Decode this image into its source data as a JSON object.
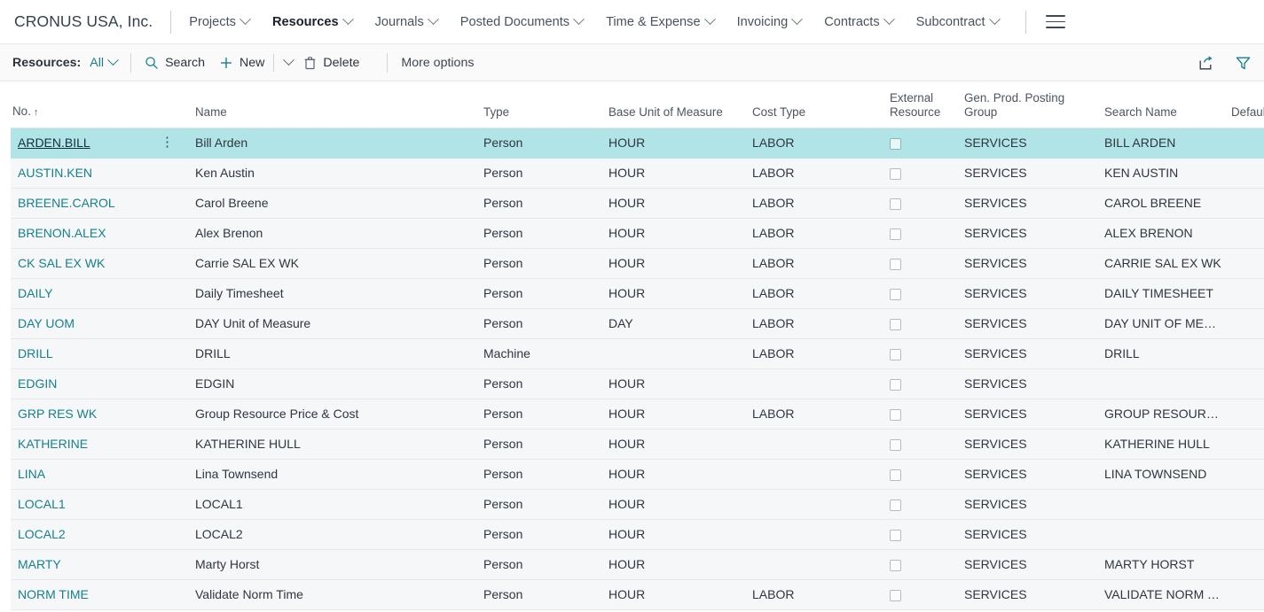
{
  "header": {
    "company": "CRONUS USA, Inc.",
    "nav": [
      {
        "label": "Projects",
        "active": false,
        "has_chevron": true
      },
      {
        "label": "Resources",
        "active": true,
        "has_chevron": true
      },
      {
        "label": "Journals",
        "active": false,
        "has_chevron": true
      },
      {
        "label": "Posted Documents",
        "active": false,
        "has_chevron": true
      },
      {
        "label": "Time & Expense",
        "active": false,
        "has_chevron": true
      },
      {
        "label": "Invoicing",
        "active": false,
        "has_chevron": true
      },
      {
        "label": "Contracts",
        "active": false,
        "has_chevron": true
      },
      {
        "label": "Subcontract",
        "active": false,
        "has_chevron": true
      }
    ],
    "menu_icon": "hamburger-icon"
  },
  "toolbar": {
    "list_label": "Resources:",
    "view_selector": "All",
    "search_label": "Search",
    "search_icon": "search-icon",
    "new_label": "New",
    "new_icon": "plus-icon",
    "delete_label": "Delete",
    "delete_icon": "trash-icon",
    "more_options_label": "More options",
    "share_icon": "share-icon",
    "filter_icon": "filter-icon"
  },
  "grid": {
    "columns": [
      {
        "key": "no",
        "label": "No.",
        "sorted": "ascending",
        "sort_glyph": "↑"
      },
      {
        "key": "name",
        "label": "Name"
      },
      {
        "key": "type",
        "label": "Type"
      },
      {
        "key": "base_uom",
        "label": "Base Unit of Measure"
      },
      {
        "key": "cost_type",
        "label": "Cost Type"
      },
      {
        "key": "external",
        "label": "External Resource"
      },
      {
        "key": "gen_prod",
        "label": "Gen. Prod. Posting Group"
      },
      {
        "key": "search_name",
        "label": "Search Name"
      },
      {
        "key": "default_de",
        "label": "Default De"
      }
    ],
    "row_menu_glyph": "⋮",
    "rows": [
      {
        "no": "ARDEN.BILL",
        "name": "Bill Arden",
        "type": "Person",
        "base_uom": "HOUR",
        "cost_type": "LABOR",
        "external": false,
        "gen_prod": "SERVICES",
        "search_name": "BILL ARDEN",
        "selected": true
      },
      {
        "no": "AUSTIN.KEN",
        "name": "Ken Austin",
        "type": "Person",
        "base_uom": "HOUR",
        "cost_type": "LABOR",
        "external": false,
        "gen_prod": "SERVICES",
        "search_name": "KEN AUSTIN",
        "selected": false
      },
      {
        "no": "BREENE.CAROL",
        "name": "Carol Breene",
        "type": "Person",
        "base_uom": "HOUR",
        "cost_type": "LABOR",
        "external": false,
        "gen_prod": "SERVICES",
        "search_name": "CAROL BREENE",
        "selected": false
      },
      {
        "no": "BRENON.ALEX",
        "name": "Alex Brenon",
        "type": "Person",
        "base_uom": "HOUR",
        "cost_type": "LABOR",
        "external": false,
        "gen_prod": "SERVICES",
        "search_name": "ALEX BRENON",
        "selected": false
      },
      {
        "no": "CK SAL EX WK",
        "name": "Carrie SAL EX WK",
        "type": "Person",
        "base_uom": "HOUR",
        "cost_type": "LABOR",
        "external": false,
        "gen_prod": "SERVICES",
        "search_name": "CARRIE SAL EX WK",
        "selected": false
      },
      {
        "no": "DAILY",
        "name": "Daily Timesheet",
        "type": "Person",
        "base_uom": "HOUR",
        "cost_type": "LABOR",
        "external": false,
        "gen_prod": "SERVICES",
        "search_name": "DAILY TIMESHEET",
        "selected": false
      },
      {
        "no": "DAY UOM",
        "name": "DAY Unit of Measure",
        "type": "Person",
        "base_uom": "DAY",
        "cost_type": "LABOR",
        "external": false,
        "gen_prod": "SERVICES",
        "search_name": "DAY UNIT OF MEAS...",
        "selected": false
      },
      {
        "no": "DRILL",
        "name": "DRILL",
        "type": "Machine",
        "base_uom": "",
        "cost_type": "LABOR",
        "external": false,
        "gen_prod": "SERVICES",
        "search_name": "DRILL",
        "selected": false
      },
      {
        "no": "EDGIN",
        "name": "EDGIN",
        "type": "Person",
        "base_uom": "HOUR",
        "cost_type": "",
        "external": false,
        "gen_prod": "SERVICES",
        "search_name": "",
        "selected": false
      },
      {
        "no": "GRP RES WK",
        "name": "Group Resource Price & Cost",
        "type": "Person",
        "base_uom": "HOUR",
        "cost_type": "LABOR",
        "external": false,
        "gen_prod": "SERVICES",
        "search_name": "GROUP RESOURCE ...",
        "selected": false
      },
      {
        "no": "KATHERINE",
        "name": "KATHERINE HULL",
        "type": "Person",
        "base_uom": "HOUR",
        "cost_type": "",
        "external": false,
        "gen_prod": "SERVICES",
        "search_name": "KATHERINE HULL",
        "selected": false
      },
      {
        "no": "LINA",
        "name": "Lina Townsend",
        "type": "Person",
        "base_uom": "HOUR",
        "cost_type": "",
        "external": false,
        "gen_prod": "SERVICES",
        "search_name": "LINA TOWNSEND",
        "selected": false
      },
      {
        "no": "LOCAL1",
        "name": "LOCAL1",
        "type": "Person",
        "base_uom": "HOUR",
        "cost_type": "",
        "external": false,
        "gen_prod": "SERVICES",
        "search_name": "",
        "selected": false
      },
      {
        "no": "LOCAL2",
        "name": "LOCAL2",
        "type": "Person",
        "base_uom": "HOUR",
        "cost_type": "",
        "external": false,
        "gen_prod": "SERVICES",
        "search_name": "",
        "selected": false
      },
      {
        "no": "MARTY",
        "name": "Marty Horst",
        "type": "Person",
        "base_uom": "HOUR",
        "cost_type": "",
        "external": false,
        "gen_prod": "SERVICES",
        "search_name": "MARTY HORST",
        "selected": false
      },
      {
        "no": "NORM TIME",
        "name": "Validate Norm Time",
        "type": "Person",
        "base_uom": "HOUR",
        "cost_type": "LABOR",
        "external": false,
        "gen_prod": "SERVICES",
        "search_name": "VALIDATE NORM TI...",
        "selected": false
      }
    ]
  },
  "colors": {
    "accent_teal": "#17808c",
    "selected_row": "#b0e4e6",
    "row_bg": "#f6f7f8",
    "text": "#2e3640"
  }
}
